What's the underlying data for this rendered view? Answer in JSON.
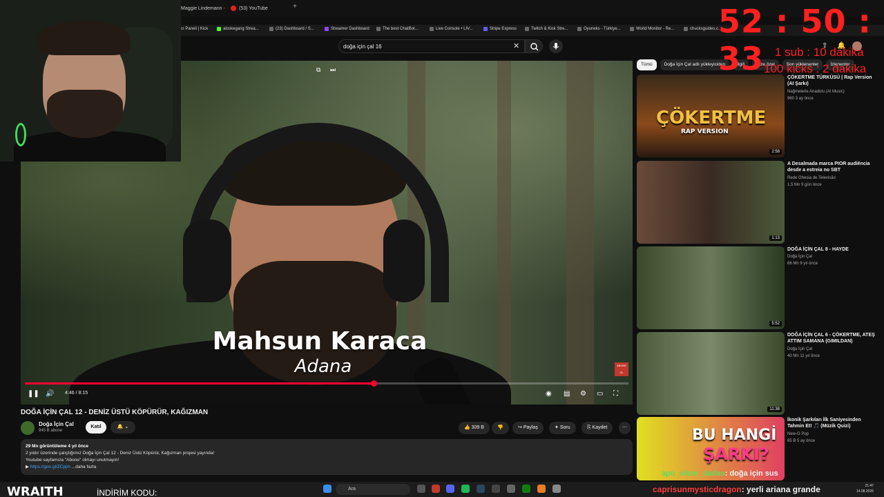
{
  "browser": {
    "tabs": [
      {
        "label": "Maggie Lindemann - "
      },
      {
        "label": "(53) YouTube"
      }
    ],
    "bookmarks": [
      "cı Paneli | Kick",
      "aloskegang Strea...",
      "(23) Dashboard / S...",
      "Streamer Dashboard",
      "The best ChatBot...",
      "Live Console • LIV...",
      "Stripe Express",
      "Twitch & Kick Stre...",
      "Oyuneks - Türkiye...",
      "World Monitor - Re...",
      "chucksguides.c..."
    ]
  },
  "search": {
    "query": "doğa için çal 16"
  },
  "player": {
    "lower_third_name": "Mahsun Karaca",
    "lower_third_place": "Adana",
    "time": "4:46 / 8:15",
    "progress": 0.578,
    "abone_badge": "ABONE OL"
  },
  "video": {
    "title": "DOĞA İÇİN ÇAL 12 - DENİZ ÜSTÜ KÖPÜRÜR, KAĞIZMAN",
    "channel": "Doğa İçin Çal",
    "subscribers": "945 B abone",
    "join_label": "Katıl",
    "likes": "309 B",
    "share_label": "Paylaş",
    "ask_label": "Soru",
    "save_label": "Kaydet"
  },
  "description": {
    "meta": "29 Mn görüntüleme  4 yıl önce",
    "line1": "2 yıldır üzerinde çalıştığımız Doğa İçin Çal 12 - Deniz Üstü Köpürür, Kağızman projesi yayında!",
    "line2": "Youtube sayfamıza \"Abone\" olmayı unutmayın!",
    "link": "https://goo.gl/ZCpjm",
    "more": "...daha fazla"
  },
  "chips": [
    "Tümü",
    "Doğa İçin Çal adlı yükleyiciden",
    "İlgili",
    "Size özel",
    "Son yüklenenler",
    "İzlenenler"
  ],
  "recommendations": [
    {
      "title": "ÇÖKERTME TÜRKÜSÜ | Rap Version (AI Şarkı)",
      "channel": "Nağmelerle Anadolu (AI Music)",
      "meta": "960  3 ay önce",
      "duration": "2:58",
      "thumb_text": "ÇÖKERTME",
      "thumb_sub": "RAP VERSION"
    },
    {
      "title": "A Desalmada marca PIOR audiência desde a estreia no SBT",
      "channel": "Rede Ghesia de Televisão",
      "meta": "1,5 Mn  9 gün önce",
      "duration": "1:13"
    },
    {
      "title": "DOĞA İÇİN ÇAL 8 - HAYDE",
      "channel": "Doğa İçin Çal",
      "meta": "66 Mn  9 yıl önce",
      "duration": "5:52"
    },
    {
      "title": "DOĞA İÇİN ÇAL 6 - ÇÖKERTME, ATEŞ ATTIM SAMANA (GIMILDAN)",
      "channel": "Doğa İçin Çal",
      "meta": "40 Mn  11 yıl önce",
      "duration": "11:38"
    },
    {
      "title": "İkonik Şarkıları İlk Saniyesinden Tahmin Et! 🎵 (Müzik Quizi)",
      "channel": "New-G Pop",
      "meta": "65 B  5 ay önce",
      "thumb_text": "BU HANGİ",
      "thumb_sub": "ŞARKI?"
    }
  ],
  "overlay": {
    "timer": "52 : 50 : 33",
    "sub_rule": "1 sub : 10 dakika",
    "kick_rule": "100 kicks : 2 dakika",
    "chat": [
      {
        "user": "apo_siken_dadas",
        "message": ": doğa için sus"
      },
      {
        "user": "caprisunmysticdragon",
        "message": ": yerli ariana grande"
      }
    ],
    "brand": "WRAITH",
    "promo": "İNDİRİM KODU:"
  },
  "taskbar": {
    "search_placeholder": "Ara",
    "time": "21:47",
    "date": "14.08.2026"
  },
  "colors": {
    "accent": "#ff0033",
    "timer": "#ff2020",
    "link": "#3ea6ff"
  }
}
